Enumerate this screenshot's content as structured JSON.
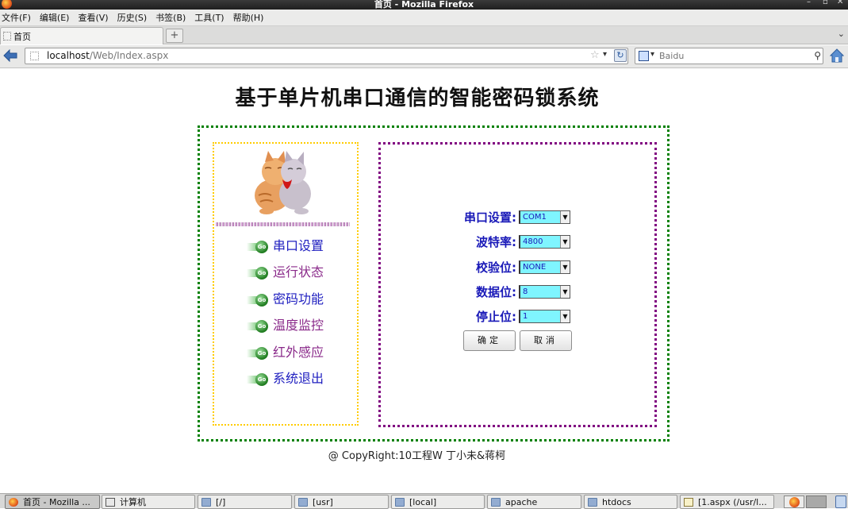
{
  "window": {
    "title": "首页 - Mozilla Firefox",
    "controls": [
      "–",
      "▫",
      "✕"
    ]
  },
  "menu": {
    "items": [
      "文件(F)",
      "编辑(E)",
      "查看(V)",
      "历史(S)",
      "书签(B)",
      "工具(T)",
      "帮助(H)"
    ]
  },
  "tabs": {
    "active_label": "首页",
    "new_tab_symbol": "+",
    "list_symbol": "⌄"
  },
  "navbar": {
    "url_host": "localhost",
    "url_path": "/Web/Index.aspx",
    "search_placeholder": "Baidu"
  },
  "page": {
    "title": "基于单片机串口通信的智能密码锁系统",
    "nav_items": [
      {
        "label": "串口设置",
        "visited": false
      },
      {
        "label": "运行状态",
        "visited": true
      },
      {
        "label": "密码功能",
        "visited": false
      },
      {
        "label": "温度监控",
        "visited": true
      },
      {
        "label": "红外感应",
        "visited": true
      },
      {
        "label": "系统退出",
        "visited": false
      }
    ],
    "go_icon_text": "Go",
    "form": {
      "fields": [
        {
          "label": "串口设置:",
          "value": "COM1"
        },
        {
          "label": "波特率:",
          "value": "4800"
        },
        {
          "label": "校验位:",
          "value": "NONE"
        },
        {
          "label": "数据位:",
          "value": "8"
        },
        {
          "label": "停止位:",
          "value": "1"
        }
      ],
      "ok_label": "确定",
      "cancel_label": "取消"
    },
    "copyright": "@ CopyRight:10工程W 丁小未&蒋柯"
  },
  "taskbar": {
    "items": [
      {
        "label": "首页 - Mozilla ...",
        "icon": "firefox-icon"
      },
      {
        "label": "计算机",
        "icon": "computer-icon"
      },
      {
        "label": "[/]",
        "icon": "folder-icon"
      },
      {
        "label": "[usr]",
        "icon": "folder-icon"
      },
      {
        "label": "[local]",
        "icon": "folder-icon"
      },
      {
        "label": "apache",
        "icon": "folder-icon"
      },
      {
        "label": "htdocs",
        "icon": "folder-icon"
      },
      {
        "label": "[1.aspx (/usr/l...",
        "icon": "document-icon"
      }
    ]
  },
  "colors": {
    "outer_border": "#008000",
    "left_border": "#ffcc00",
    "right_border": "#800080",
    "select_bg": "#7ff5ff",
    "label_blue": "#1a1ab8",
    "link_blue": "#2020c0",
    "link_visited": "#8a2a8a"
  }
}
